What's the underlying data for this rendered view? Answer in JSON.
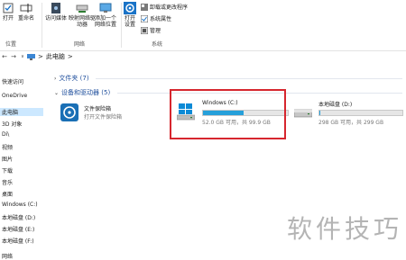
{
  "ribbon": {
    "open_label": "打开",
    "rename_label": "重命名",
    "location_group": "位置",
    "access_media_label": "访问媒体",
    "map_drive_label": "映射网络驱动器",
    "add_location_label": "添加一个网络位置",
    "network_group": "网络",
    "open_settings_label": "打开设置",
    "uninstall_label": "卸载或更改程序",
    "system_props_label": "系统属性",
    "manage_label": "管理",
    "system_group": "系统"
  },
  "address": {
    "back": "←",
    "forward": "→",
    "dropdown": "∨",
    "up": "↑",
    "path_sep": ">",
    "path": "此电脑",
    "path_sep2": ">"
  },
  "sidebar": {
    "items": [
      "快速访问",
      "OneDrive",
      "此电脑",
      "3D 对象",
      "Di\\",
      "视频",
      "图片",
      "下载",
      "音乐",
      "桌面",
      "Windows (C:)",
      "本地磁盘 (D:)",
      "本地磁盘 (E:)",
      "本地磁盘 (F:)",
      "网络"
    ]
  },
  "groups": {
    "folders": "文件夹 (7)",
    "devices": "设备和驱动器 (5)"
  },
  "items": {
    "vault_name": "文件保险箱",
    "vault_sub": "打开文件保险箱",
    "c_name": "Windows (C:)",
    "c_info": "52.0 GB 可用，共 99.9 GB",
    "c_used_fraction": 0.48,
    "d_name": "本地磁盘 (D:)",
    "d_info": "298 GB 可用，共 299 GB",
    "d_used_fraction": 0.01
  },
  "watermark": "软件技巧",
  "colors": {
    "accent": "#26a0da",
    "highlight_border": "#d6262e",
    "selected_bg": "#cce8ff",
    "group_header": "#1e4e9c"
  }
}
